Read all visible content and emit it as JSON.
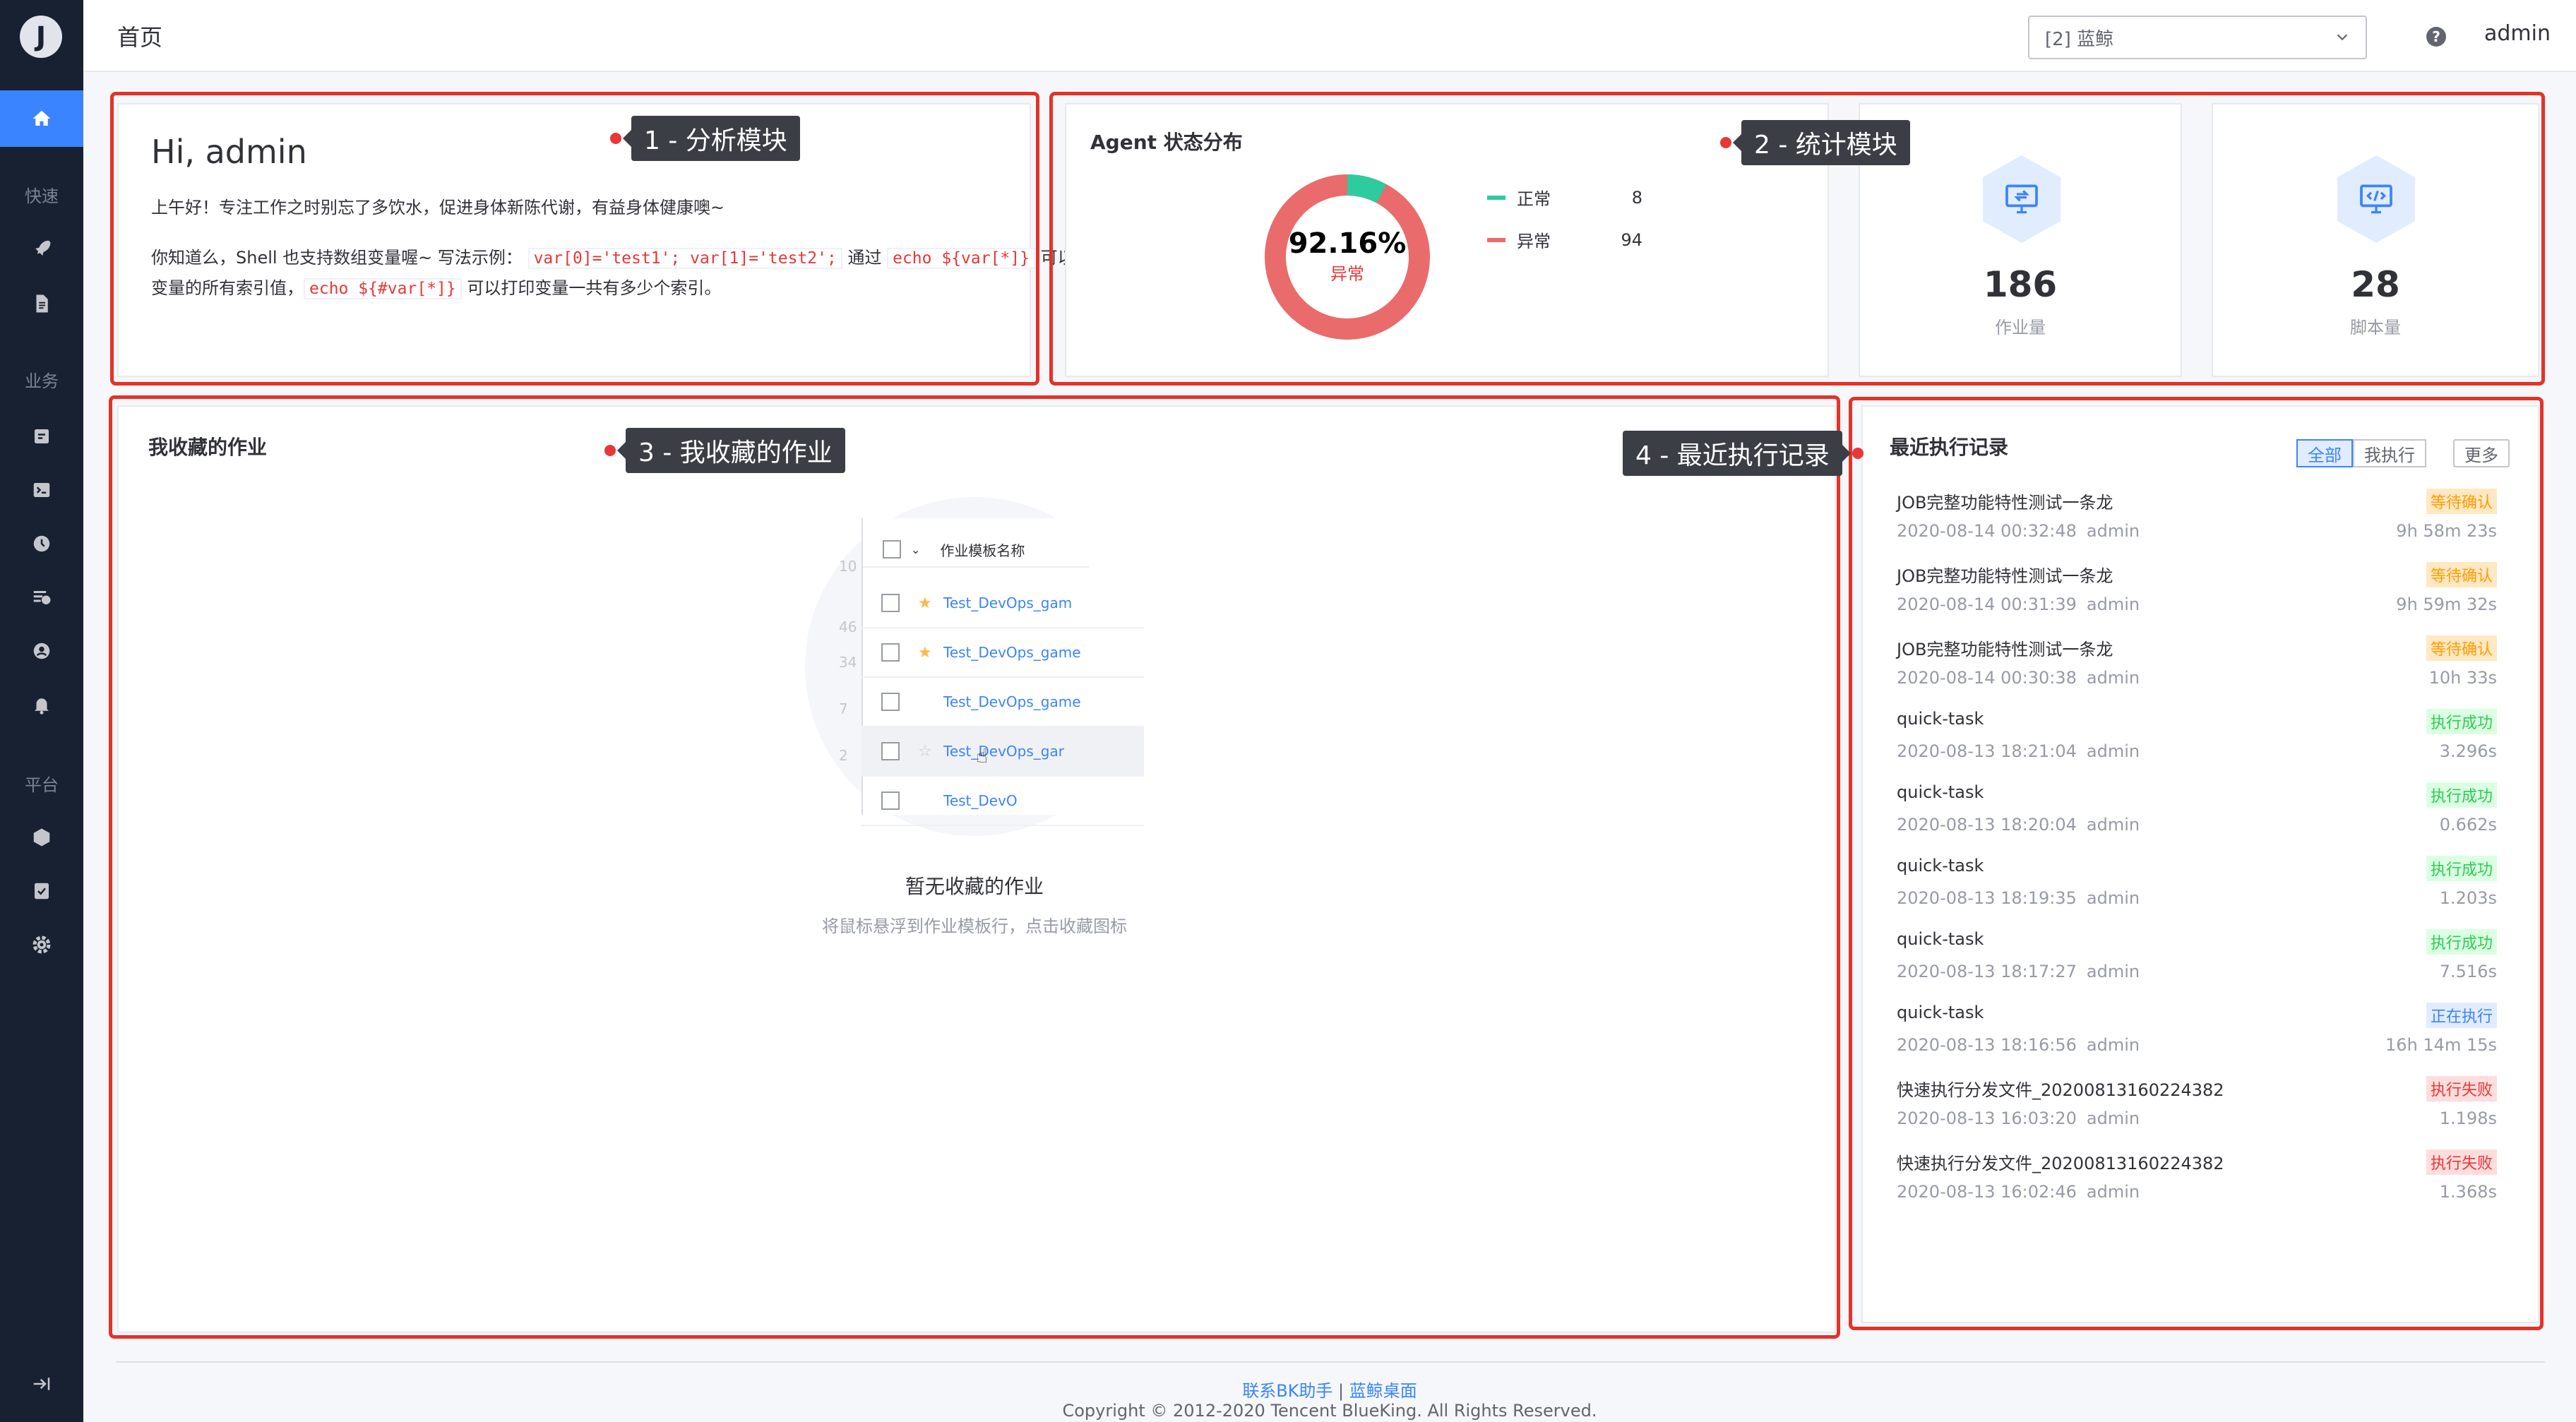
{
  "sidebar": {
    "logo": "J",
    "groups": [
      "快速",
      "业务",
      "平台"
    ]
  },
  "header": {
    "title": "首页",
    "business_select": "[2] 蓝鲸",
    "help": "?",
    "user": "admin"
  },
  "annotations": [
    "1 - 分析模块",
    "2 - 统计模块",
    "3 - 我收藏的作业",
    "4 - 最近执行记录"
  ],
  "analysis": {
    "greeting": "Hi, admin",
    "message": "上午好！专注工作之时别忘了多饮水，促进身体新陈代谢，有益身体健康噢~",
    "tip_p1": "你知道么，Shell 也支持数组变量喔~ 写法示例：",
    "tip_code1": "var[0]='test1'; var[1]='test2';",
    "tip_p2": "通过",
    "tip_code2": "echo ${var[*]}",
    "tip_p3": "可以打印变量的所有索引值，",
    "tip_code3": "echo ${#var[*]}",
    "tip_p4": "可以打印变量一共有多少个索引。"
  },
  "agent": {
    "title": "Agent 状态分布",
    "percent": "92.16%",
    "percent_label": "异常",
    "legend": [
      {
        "label": "正常",
        "value": "8",
        "color": "#2dcb9d"
      },
      {
        "label": "异常",
        "value": "94",
        "color": "#ea6b6b"
      }
    ],
    "normal_fraction": 0.0784
  },
  "stats": [
    {
      "value": "186",
      "label": "作业量"
    },
    {
      "value": "28",
      "label": "脚本量"
    }
  ],
  "favorites": {
    "title": "我收藏的作业",
    "empty_title": "暂无收藏的作业",
    "empty_sub": "将鼠标悬浮到作业模板行，点击收藏图标",
    "illus": {
      "header": "作业模板名称",
      "rows": [
        "Test_DevOps_gam",
        "Test_DevOps_game",
        "Test_DevOps_game",
        "Test_DevOps_gar",
        "Test_DevO"
      ],
      "nums": [
        "10",
        "46",
        "34",
        "7",
        "2"
      ]
    }
  },
  "recent": {
    "title": "最近执行记录",
    "tabs": [
      "全部",
      "我执行"
    ],
    "more": "更多",
    "records": [
      {
        "name": "JOB完整功能特性测试一条龙",
        "status": "等待确认",
        "st": "wait",
        "time": "2020-08-14 00:32:48",
        "user": "admin",
        "duration": "9h 58m 23s"
      },
      {
        "name": "JOB完整功能特性测试一条龙",
        "status": "等待确认",
        "st": "wait",
        "time": "2020-08-14 00:31:39",
        "user": "admin",
        "duration": "9h 59m 32s"
      },
      {
        "name": "JOB完整功能特性测试一条龙",
        "status": "等待确认",
        "st": "wait",
        "time": "2020-08-14 00:30:38",
        "user": "admin",
        "duration": "10h 33s"
      },
      {
        "name": "quick-task",
        "status": "执行成功",
        "st": "ok",
        "time": "2020-08-13 18:21:04",
        "user": "admin",
        "duration": "3.296s"
      },
      {
        "name": "quick-task",
        "status": "执行成功",
        "st": "ok",
        "time": "2020-08-13 18:20:04",
        "user": "admin",
        "duration": "0.662s"
      },
      {
        "name": "quick-task",
        "status": "执行成功",
        "st": "ok",
        "time": "2020-08-13 18:19:35",
        "user": "admin",
        "duration": "1.203s"
      },
      {
        "name": "quick-task",
        "status": "执行成功",
        "st": "ok",
        "time": "2020-08-13 18:17:27",
        "user": "admin",
        "duration": "7.516s"
      },
      {
        "name": "quick-task",
        "status": "正在执行",
        "st": "run",
        "time": "2020-08-13 18:16:56",
        "user": "admin",
        "duration": "16h 14m 15s"
      },
      {
        "name": "快速执行分发文件_20200813160224382",
        "status": "执行失败",
        "st": "fail",
        "time": "2020-08-13 16:03:20",
        "user": "admin",
        "duration": "1.198s"
      },
      {
        "name": "快速执行分发文件_20200813160224382",
        "status": "执行失败",
        "st": "fail",
        "time": "2020-08-13 16:02:46",
        "user": "admin",
        "duration": "1.368s"
      }
    ]
  },
  "footer": {
    "link1": "联系BK助手",
    "sep": "|",
    "link2": "蓝鲸桌面",
    "copyright": "Copyright © 2012-2020 Tencent BlueKing. All Rights Reserved."
  }
}
